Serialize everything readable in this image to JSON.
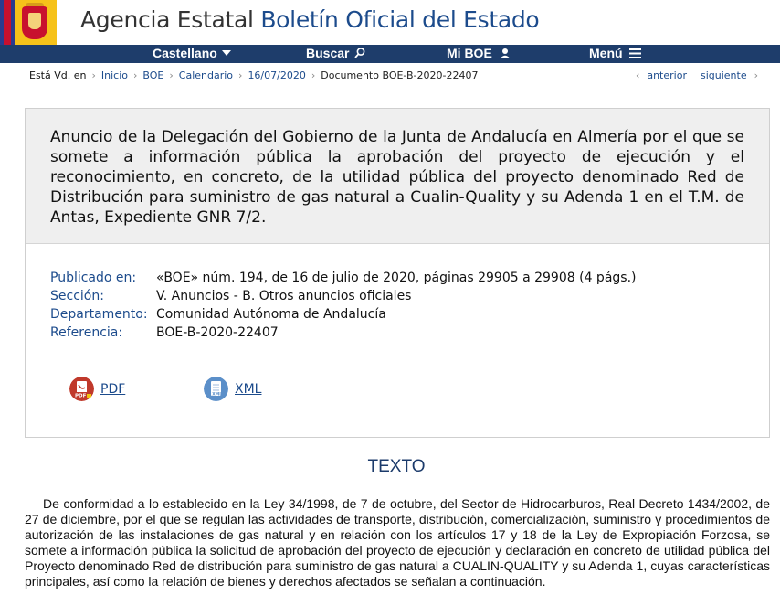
{
  "header": {
    "title_part1": "Agencia Estatal",
    "title_part2": "Boletín Oficial del Estado"
  },
  "nav": {
    "language": "Castellano",
    "search": "Buscar",
    "my_boe": "Mi BOE",
    "menu": "Menú"
  },
  "breadcrumb": {
    "prefix": "Está Vd. en",
    "items": [
      "Inicio",
      "BOE",
      "Calendario",
      "16/07/2020"
    ],
    "current": "Documento BOE-B-2020-22407"
  },
  "pager": {
    "prev": "anterior",
    "next": "siguiente"
  },
  "document": {
    "title": "Anuncio de la Delegación del Gobierno de la Junta de Andalucía en Almería por el que se somete a información pública la aprobación del proyecto de ejecución y el reconocimiento, en concreto, de la utilidad pública del proyecto denominado Red de Distribución para suministro de gas natural a Cualin-Quality y su Adenda 1 en el T.M. de Antas, Expediente GNR 7/2.",
    "meta": [
      {
        "label": "Publicado en:",
        "value": "«BOE» núm. 194, de 16 de julio de 2020, páginas 29905 a 29908 (4 págs.)"
      },
      {
        "label": "Sección:",
        "value": "V. Anuncios - B. Otros anuncios oficiales"
      },
      {
        "label": "Departamento:",
        "value": "Comunidad Autónoma de Andalucía"
      },
      {
        "label": "Referencia:",
        "value": "BOE-B-2020-22407"
      }
    ],
    "downloads": {
      "pdf": "PDF",
      "xml": "XML"
    }
  },
  "texto": {
    "heading": "TEXTO",
    "paragraph": "De conformidad a lo establecido en la Ley 34/1998, de 7 de octubre, del Sector de Hidrocarburos, Real Decreto 1434/2002, de 27 de diciembre, por el que se regulan las actividades de transporte, distribución, comercialización, suministro y procedimientos de autorización de las instalaciones de gas natural y en relación con los artículos 17 y 18 de la Ley de Expropiación Forzosa, se somete a información pública la solicitud de aprobación del proyecto de ejecución y declaración en concreto de utilidad pública del Proyecto denominado Red de distribución para suministro de gas natural a CUALIN-QUALITY y su Adenda 1, cuyas características principales, así como la relación de bienes y derechos afectados se señalan a continuación."
  },
  "colors": {
    "navbar": "#1e3d6b",
    "link": "#1c4b8c",
    "title_box": "#efefef"
  },
  "icons": [
    "coat-of-arms-logo",
    "chevron-down-icon",
    "search-icon",
    "user-icon",
    "hamburger-icon",
    "chevron-right-icon",
    "chevron-left-icon",
    "pdf-icon",
    "xml-icon"
  ]
}
